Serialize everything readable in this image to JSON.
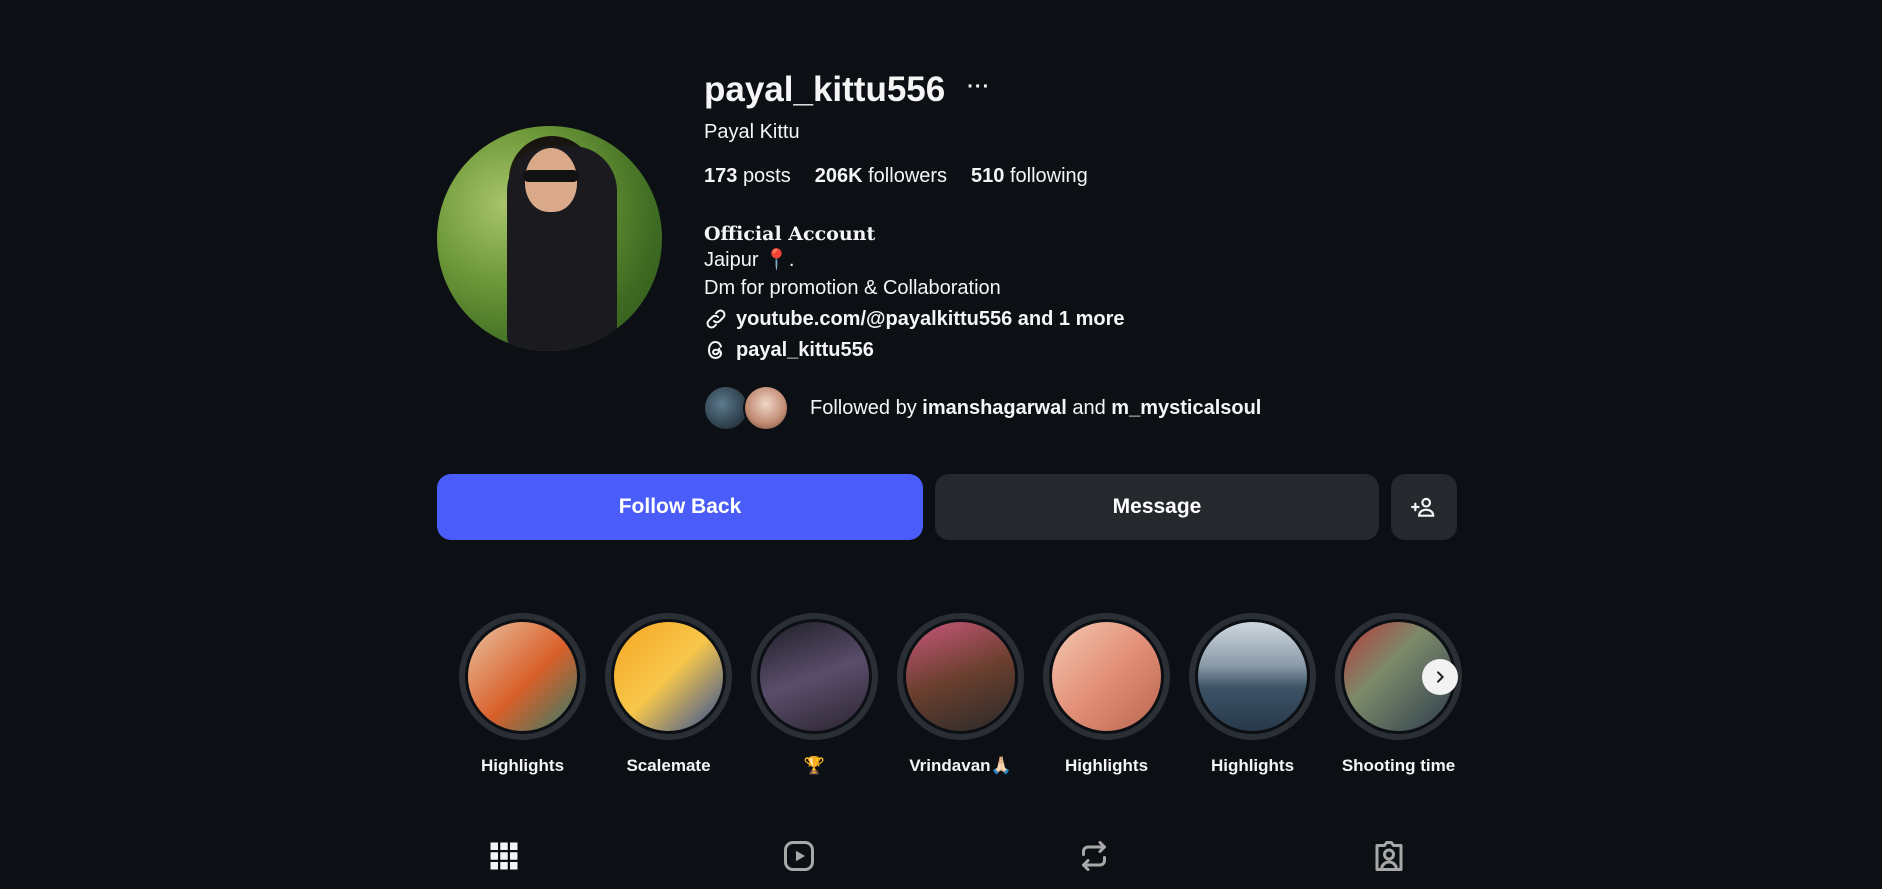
{
  "profile": {
    "username": "payal_kittu556",
    "more_label": "···",
    "full_name": "Payal Kittu",
    "stats": {
      "posts_count": "173",
      "posts_label": "posts",
      "followers_count": "206K",
      "followers_label": "followers",
      "following_count": "510",
      "following_label": "following"
    },
    "bio": {
      "title": "Official Account",
      "line1": "Jaipur 📍.",
      "line2": "Dm for promotion & Collaboration",
      "link": "youtube.com/@payalkittu556 and 1 more",
      "threads": "payal_kittu556"
    },
    "followed_by": {
      "prefix": "Followed by",
      "user1": "imanshagarwal",
      "joiner": "and",
      "user2": "m_mysticalsoul"
    }
  },
  "actions": {
    "follow_back": "Follow Back",
    "message": "Message"
  },
  "highlights": [
    {
      "label": "Highlights",
      "bg": "linear-gradient(135deg,#e9c2a0,#d95f2a 55%,#2f7d6a)"
    },
    {
      "label": "Scalemate",
      "bg": "linear-gradient(135deg,#f5a623,#f7c64a 50%,#2b4d9a)"
    },
    {
      "label": "🏆",
      "bg": "linear-gradient(160deg,#1e1e26,#5a4d6b 50%,#2b2530)"
    },
    {
      "label": "Vrindavan🙏🏻",
      "bg": "linear-gradient(160deg,#c9577b,#6a3f2e 50%,#2a2a2a)"
    },
    {
      "label": "Highlights",
      "bg": "linear-gradient(135deg,#f3c9b1,#e38f78 50%,#b7664f)"
    },
    {
      "label": "Highlights",
      "bg": "linear-gradient(180deg,#cfd8e0,#8a9aa8 40%,#3d5366 60%,#27394a)"
    },
    {
      "label": "Shooting time",
      "bg": "linear-gradient(135deg,#b63a3a,#7c8a6a 40%,#2e3c4e)"
    }
  ],
  "colors": {
    "background": "#0c1014",
    "primary_button": "#4a5df9",
    "secondary_button": "#25292e"
  },
  "tabs": [
    "posts-grid-icon",
    "reels-icon",
    "reposts-icon",
    "tagged-icon"
  ]
}
